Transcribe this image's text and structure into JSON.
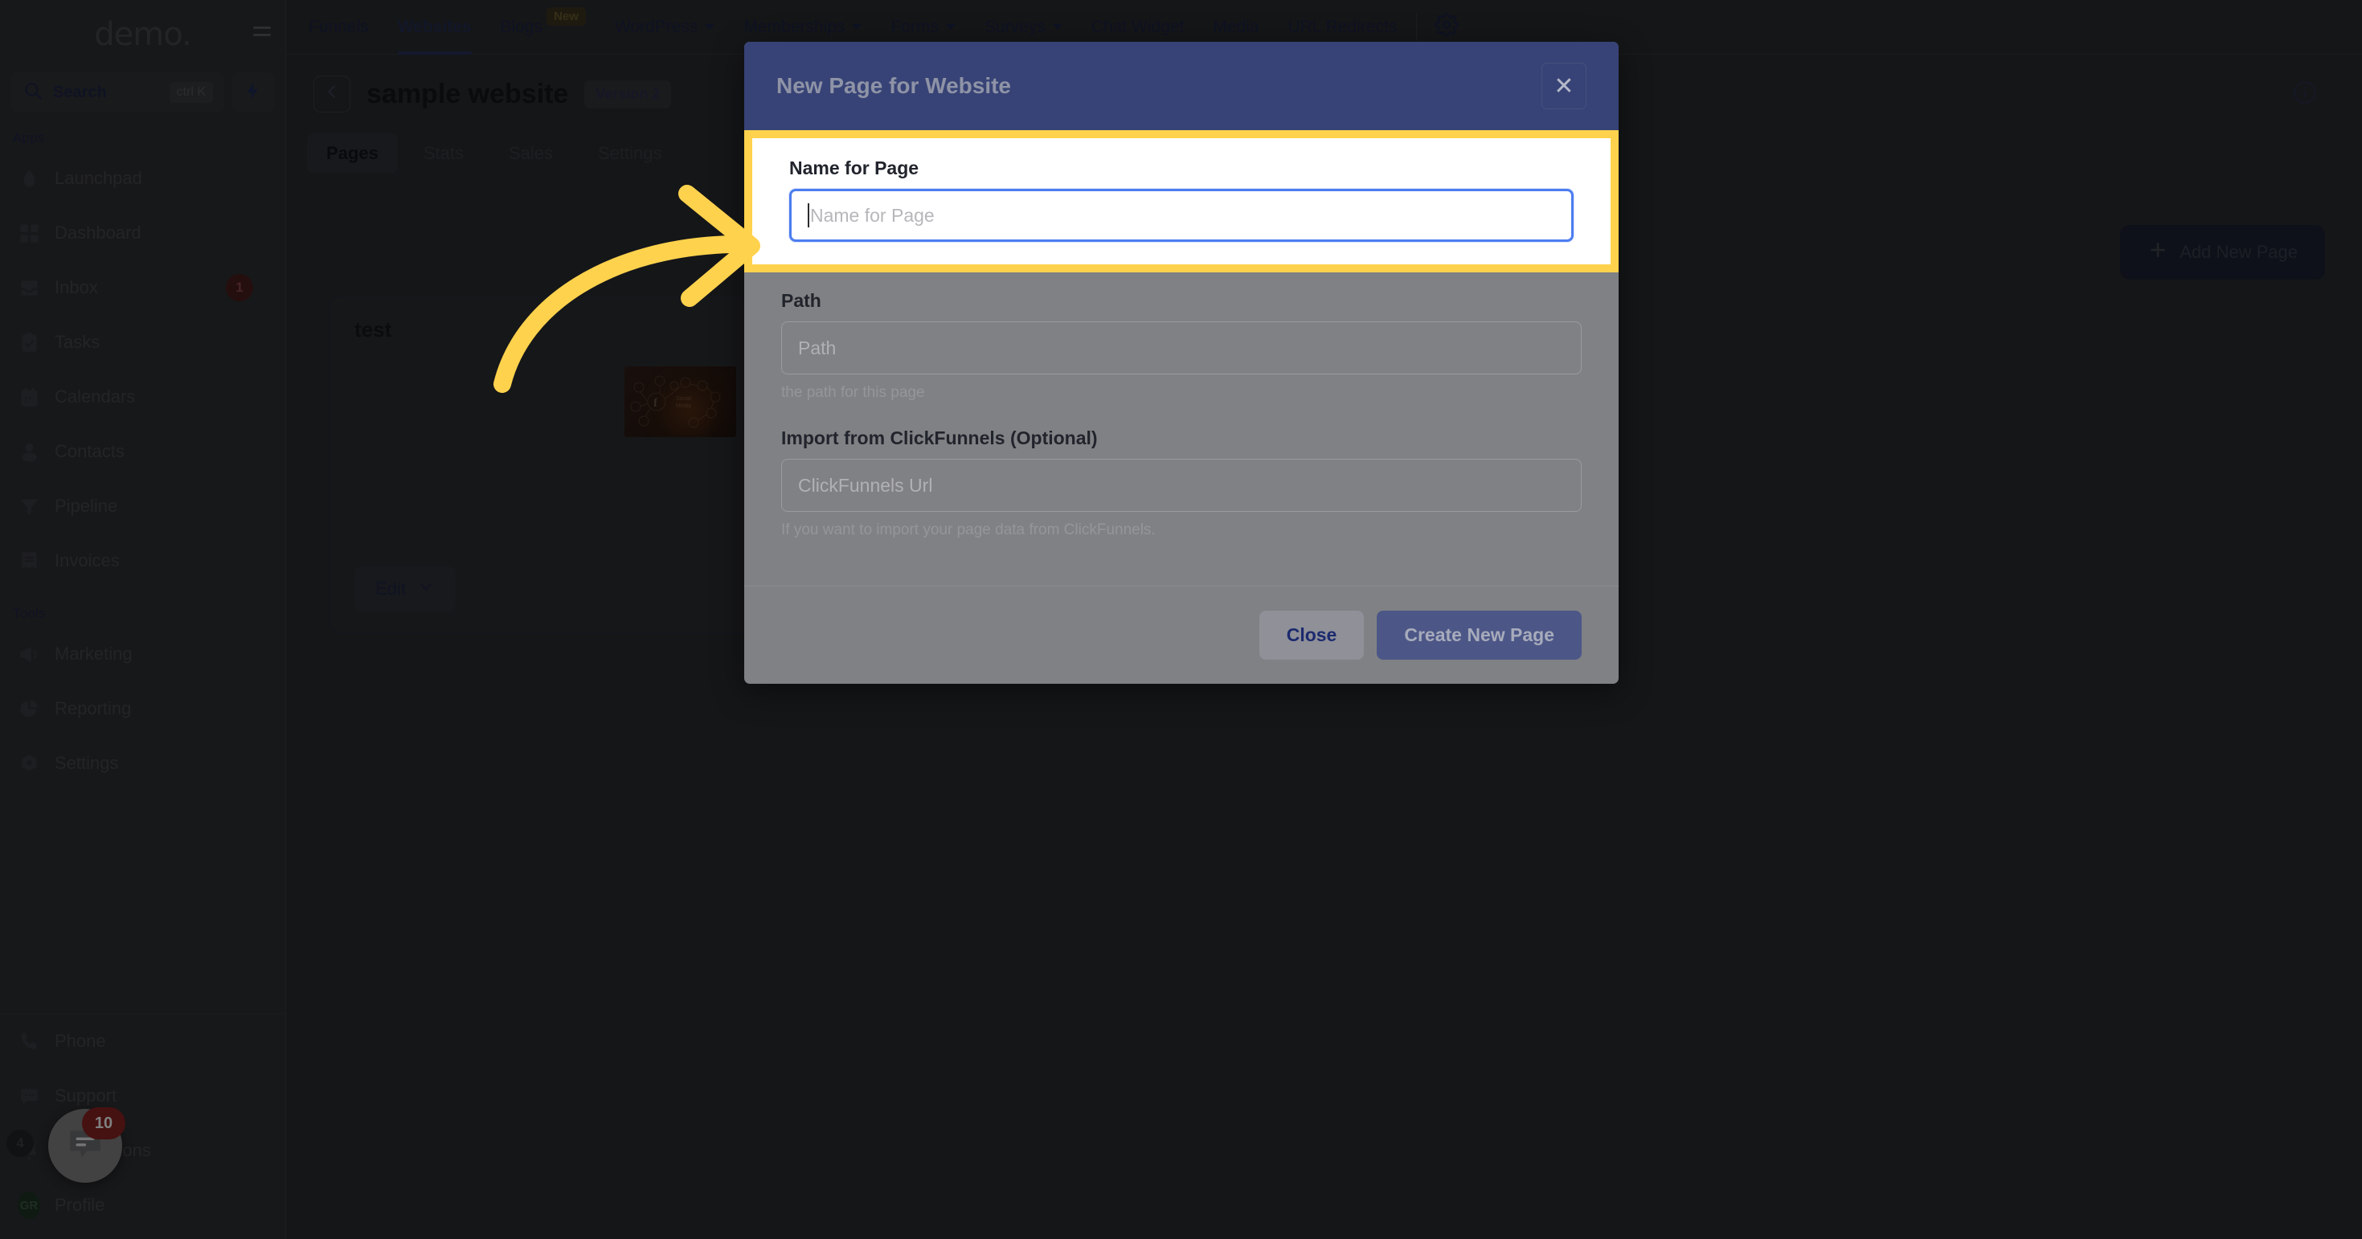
{
  "sidebar": {
    "logo": "demo.",
    "search": {
      "label": "Search",
      "shortcut": "ctrl K"
    },
    "sections": [
      {
        "title": "Apps",
        "items": [
          {
            "label": "Launchpad",
            "icon": "launchpad-icon",
            "badge": ""
          },
          {
            "label": "Dashboard",
            "icon": "dashboard-icon",
            "badge": ""
          },
          {
            "label": "Inbox",
            "icon": "inbox-icon",
            "badge": "1"
          },
          {
            "label": "Tasks",
            "icon": "tasks-icon",
            "badge": ""
          },
          {
            "label": "Calendars",
            "icon": "calendar-icon",
            "badge": ""
          },
          {
            "label": "Contacts",
            "icon": "contacts-icon",
            "badge": ""
          },
          {
            "label": "Pipeline",
            "icon": "pipeline-icon",
            "badge": ""
          },
          {
            "label": "Invoices",
            "icon": "invoices-icon",
            "badge": ""
          }
        ]
      },
      {
        "title": "Tools",
        "items": [
          {
            "label": "Marketing",
            "icon": "megaphone-icon",
            "badge": ""
          },
          {
            "label": "Reporting",
            "icon": "pie-chart-icon",
            "badge": ""
          },
          {
            "label": "Settings",
            "icon": "gear-icon",
            "badge": ""
          }
        ]
      }
    ],
    "bottom_items": [
      {
        "label": "Phone",
        "icon": "phone-icon",
        "badge": ""
      },
      {
        "label": "Support",
        "icon": "chat-icon",
        "badge": ""
      },
      {
        "label": "Notifications",
        "icon": "bell-icon",
        "badge": "4"
      },
      {
        "label": "Profile",
        "icon": "avatar-icon",
        "badge": "",
        "initials": "GR"
      }
    ]
  },
  "topnav": {
    "items": [
      {
        "label": "Funnels",
        "dropdown": false,
        "active": false,
        "badge": ""
      },
      {
        "label": "Websites",
        "dropdown": false,
        "active": true,
        "badge": ""
      },
      {
        "label": "Blogs",
        "dropdown": false,
        "active": false,
        "badge": "New"
      },
      {
        "label": "WordPress",
        "dropdown": true,
        "active": false,
        "badge": ""
      },
      {
        "label": "Memberships",
        "dropdown": true,
        "active": false,
        "badge": ""
      },
      {
        "label": "Forms",
        "dropdown": true,
        "active": false,
        "badge": ""
      },
      {
        "label": "Surveys",
        "dropdown": true,
        "active": false,
        "badge": ""
      },
      {
        "label": "Chat Widget",
        "dropdown": false,
        "active": false,
        "badge": ""
      },
      {
        "label": "Media",
        "dropdown": false,
        "active": false,
        "badge": ""
      },
      {
        "label": "URL Redirects",
        "dropdown": false,
        "active": false,
        "badge": ""
      }
    ],
    "settings_icon": "gear-icon"
  },
  "page_header": {
    "back_icon": "chevron-left-icon",
    "title": "sample website",
    "version_badge": "Version 2",
    "info_icon": "info-circle-icon",
    "tabs": [
      {
        "label": "Pages",
        "active": true
      },
      {
        "label": "Stats",
        "active": false
      },
      {
        "label": "Sales",
        "active": false
      },
      {
        "label": "Settings",
        "active": false
      }
    ]
  },
  "content": {
    "add_page_button": "Add New Page",
    "add_page_icon": "plus-icon",
    "card": {
      "title": "test",
      "edit_button": "Edit",
      "edit_caret_icon": "chevron-down-icon"
    }
  },
  "modal": {
    "title": "New Page for Website",
    "close_icon": "close-x-icon",
    "close_symbol": "✕",
    "fields": {
      "name": {
        "label": "Name for Page",
        "placeholder": "Name for Page",
        "value": "",
        "focused": true
      },
      "path": {
        "label": "Path",
        "placeholder": "Path",
        "value": "",
        "hint": "the path for this page"
      },
      "import": {
        "label": "Import from ClickFunnels (Optional)",
        "placeholder": "ClickFunnels Url",
        "value": "",
        "hint": "If you want to import your page data from ClickFunnels."
      }
    },
    "buttons": {
      "close": "Close",
      "create": "Create New Page"
    }
  },
  "annotation": {
    "arrow_color": "#FFD24D",
    "highlight_color": "#FFD24D",
    "target": "Name for Page"
  },
  "chat_widget": {
    "badge": "10",
    "icon": "chat-bubble-icon"
  },
  "colors": {
    "modal_header": "#374376",
    "primary_button": "#4C5787",
    "focus_ring": "#4C7DF0",
    "highlight": "#FFD24D"
  }
}
